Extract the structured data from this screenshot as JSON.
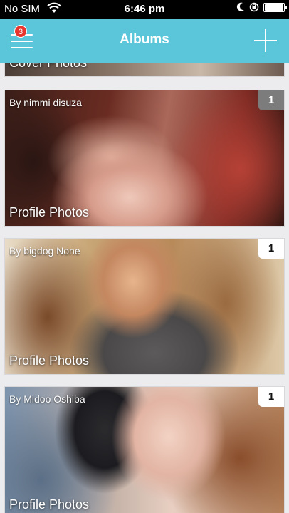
{
  "status_bar": {
    "carrier": "No SIM",
    "time": "6:46 pm"
  },
  "nav": {
    "title": "Albums",
    "badge_count": "3",
    "accent_color": "#5bc6da",
    "badge_color": "#e8352d"
  },
  "albums": [
    {
      "owner": "",
      "name": "Cover Photos",
      "count": ""
    },
    {
      "owner": "By nimmi disuza",
      "name": "Profile Photos",
      "count": "1"
    },
    {
      "owner": "By bigdog None",
      "name": "Profile Photos",
      "count": "1"
    },
    {
      "owner": "By Midoo Oshiba",
      "name": "Profile Photos",
      "count": "1"
    }
  ]
}
